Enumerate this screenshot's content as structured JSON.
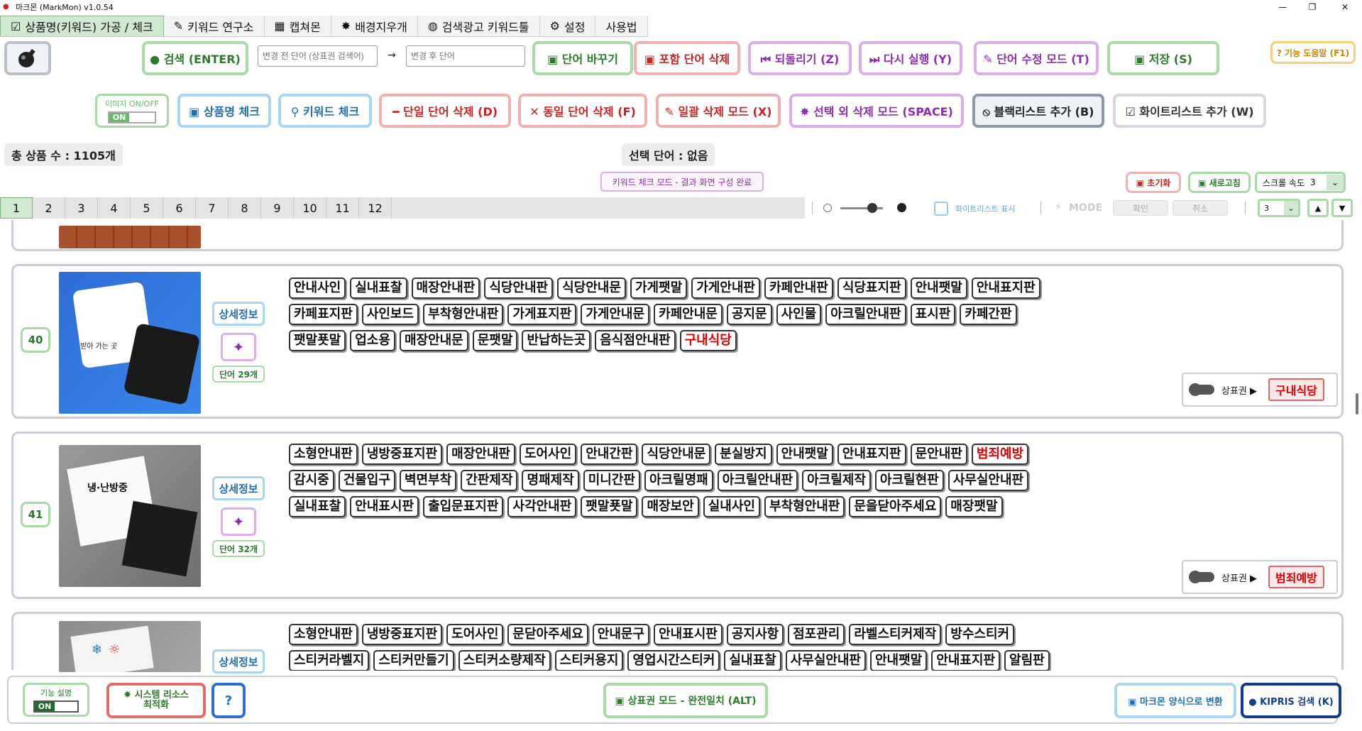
{
  "window": {
    "title": "마크몬 (MarkMon) v1.0.54",
    "min": "—",
    "max": "❐",
    "close": "✕"
  },
  "tabs": [
    {
      "label": "상품명(키워드) 가공 / 체크",
      "icon": "☑"
    },
    {
      "label": "키워드 연구소",
      "icon": "✎"
    },
    {
      "label": "캡쳐몬",
      "icon": "▦"
    },
    {
      "label": "배경지우개",
      "icon": "✸"
    },
    {
      "label": "검색광고 키워드툴",
      "icon": "◍"
    },
    {
      "label": "설정",
      "icon": "⚙"
    },
    {
      "label": "사용법",
      "icon": ""
    }
  ],
  "toolbar1": {
    "search": "● 검색 (ENTER)",
    "before_placeholder": "변경 전 단어 (상표권 검색어)",
    "arrow": "→",
    "after_placeholder": "변경 후 단어",
    "replace": "▣ 단어 바꾸기",
    "delete_incl": "▣ 포함 단어 삭제",
    "undo": "⏮ 되돌리기 (Z)",
    "redo": "⏭ 다시 실행 (Y)",
    "edit_mode": "✎ 단어 수정 모드 (T)",
    "save": "▣ 저장 (S)",
    "help": "? 기능 도움말 (F1)"
  },
  "toolbar2": {
    "image_toggle_label": "이미지 ON/OFF",
    "image_toggle_state": "ON",
    "product_check": "▣ 상품명 체크",
    "keyword_check": "⚲ 키워드 체크",
    "single_delete": "━ 단일 단어 삭제 (D)",
    "same_delete": "✕ 동일 단어 삭제 (F)",
    "bulk_delete": "✎ 일괄 삭제 모드 (X)",
    "except_delete": "✸ 선택 외 삭제 모드 (SPACE)",
    "blacklist": "⦸ 블랙리스트 추가 (B)",
    "whitelist": "☑ 화이트리스트 추가 (W)"
  },
  "status": {
    "total": "총 상품 수 : 1105개",
    "selected": "선택 단어 : 없음",
    "mode": "키워드 체크 모드 - 결과 화면 구성 완료",
    "reset": "▣ 초기화",
    "refresh": "▣ 새로고침",
    "scroll_speed_label": "스크롤 속도",
    "scroll_speed": "3"
  },
  "pages": [
    "1",
    "2",
    "3",
    "4",
    "5",
    "6",
    "7",
    "8",
    "9",
    "10",
    "11",
    "12"
  ],
  "controls": {
    "whitelist_show": "화이트리스트 표시",
    "mode": "MODE",
    "confirm": "확인",
    "cancel": "취소",
    "page_select": "3"
  },
  "rows": [
    {
      "num": "40",
      "detail": "상세정보",
      "count": "단어 29개",
      "words": [
        "안내사인",
        "실내표찰",
        "매장안내판",
        "식당안내판",
        "식당안내문",
        "가게팻말",
        "가게안내판",
        "카페안내판",
        "식당표지판",
        "안내팻말",
        "안내표지판",
        "카페표지판",
        "사인보드",
        "부착형안내판",
        "가게표지판",
        "가게안내문",
        "카페안내문",
        "공지문",
        "사인물",
        "아크릴안내판",
        "표시판",
        "카페간판",
        "팻말푯말",
        "업소용",
        "매장안내문",
        "문팻말",
        "반납하는곳",
        "음식점안내판",
        "구내식당"
      ],
      "red": [
        "구내식당"
      ],
      "tm_label": "상표권 ▶",
      "tm_word": "구내식당",
      "thumb_text": "받아 가는 곳"
    },
    {
      "num": "41",
      "detail": "상세정보",
      "count": "단어 32개",
      "words": [
        "소형안내판",
        "냉방중표지판",
        "매장안내판",
        "도어사인",
        "안내간판",
        "식당안내문",
        "분실방지",
        "안내팻말",
        "안내표지판",
        "문안내판",
        "범죄예방",
        "감시중",
        "건물입구",
        "벽면부착",
        "간판제작",
        "명패제작",
        "미니간판",
        "아크릴명패",
        "아크릴안내판",
        "아크릴제작",
        "아크릴현판",
        "사무실안내판",
        "실내표찰",
        "안내표시판",
        "출입문표지판",
        "사각안내판",
        "팻말푯말",
        "매장보안",
        "실내사인",
        "부착형안내판",
        "문을닫아주세요",
        "매장팻말"
      ],
      "red": [
        "범죄예방"
      ],
      "tm_label": "상표권 ▶",
      "tm_word": "범죄예방",
      "thumb_text": "냉·난방중"
    },
    {
      "num": "",
      "detail": "상세정보",
      "count": "",
      "words": [
        "소형안내판",
        "냉방중표지판",
        "도어사인",
        "문닫아주세요",
        "안내문구",
        "안내표시판",
        "공지사항",
        "점포관리",
        "라벨스티커제작",
        "방수스티커",
        "스티커라벨지",
        "스티커만들기",
        "스티커소량제작",
        "스티커용지",
        "영업시간스티커",
        "실내표찰",
        "사무실안내판",
        "안내팻말",
        "안내표지판",
        "알림판"
      ],
      "red": []
    }
  ],
  "bottom": {
    "feature_label": "기능 설명",
    "feature_state": "ON",
    "optimize": "✸ 시스템 리소스 최적화",
    "question": "?",
    "trademark_mode": "▣ 상표권 모드 - 완전일치 (ALT)",
    "convert": "▣ 마크몬 양식으로 변환",
    "kipris": "● KIPRIS 검색 (K)"
  }
}
